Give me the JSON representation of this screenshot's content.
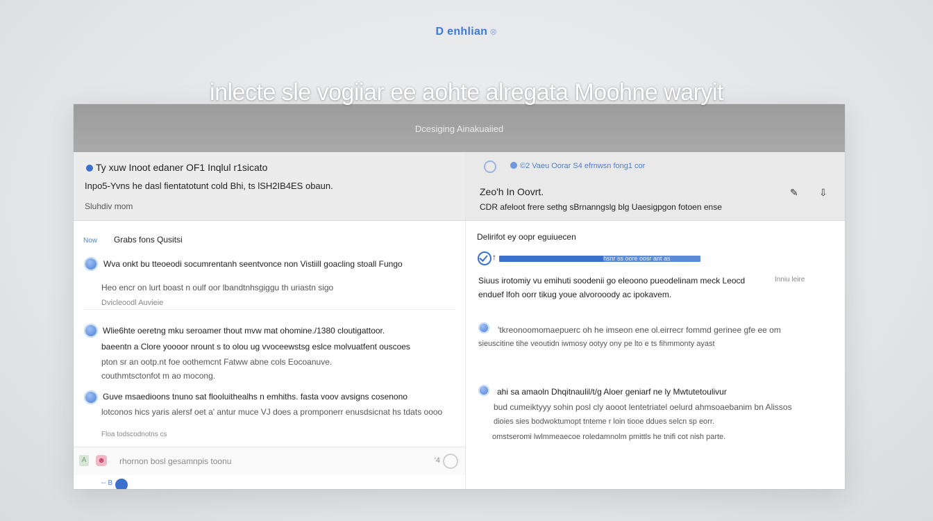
{
  "brand": {
    "name": "D enhlian",
    "mark": "⊗"
  },
  "hero": {
    "title": "inlecte sle vogiiar ee aohte alregata Moohne waryit",
    "subtitle": "Dcesiging Ainakuaiied"
  },
  "left_pane": {
    "header": {
      "title": "Ty xuw  Inoot edaner  OF1 Inqlul  r1sicato",
      "detail": "Inpo5-Yvns he dasl fientatotunt cold Bhi, ts lSH2IB4ES obaun.",
      "meta": "Sluhdiv mom"
    },
    "section": {
      "tag": "Now",
      "title": "Grabs fons Qusitsi"
    },
    "items": [
      {
        "line1": "Wva onkt bu tteoeodi socumrentanh seentvonce  non  Vistiill goacling stoall Fungo",
        "line2": "Heo encr on lurt boast n oulf oor lbandtnhsgiggu th uriastn sigo",
        "line3": "Dvicleoodl Auvieie"
      },
      {
        "line1": "Wlie6hte oeretng mku seroamer thout mvw mat ohomine./1380 cloutigattoor.",
        "line2": "baeentn  a  Clore yoooor nrount s to olou ug vvoceewstsg eslce molvuatfent ouscoes",
        "line3": "pton sr an ootp.nt foe  oothemcnt Fatww abne cols Eocoanuve.",
        "line4": "couthmtsctonfot m ao mocong."
      },
      {
        "line1": "Guve msaedioons tnuno sat flooluithealhs n emhiths. fasta voov avsigns  cosenono",
        "line2": "lotconos hics yaris alersf oet  a'  antur muce VJ does  a promponerr enusdsicnat hs tdats  oooo",
        "line3": "Floa todscodnotns cs"
      }
    ],
    "composer": {
      "placeholder": "rhornon bosl gesamnpis toonu",
      "attach_icon": "A",
      "emoji_icon": "☻",
      "count": "'4"
    },
    "footer": {
      "label": "-- B"
    }
  },
  "right_pane": {
    "header": {
      "breadcrumb": "©2 Vaeu Oorar S4 efrnwsn fong1  cor",
      "name": "Zeo'h  In  Oovrt.",
      "detail": "CDR afeloot frere sethg sBrnanngslg blg Uaesigpgon fotoen ense",
      "icons": [
        "pencil-icon",
        "share-icon"
      ]
    },
    "section": {
      "title": "Delirifot  ey oopr  eguiuecen"
    },
    "progress": {
      "value": 0.52,
      "label": "hsnr ss oore oosr ant as"
    },
    "blocks": [
      {
        "line1": "Siuus  irotomiy vu emihuti soodenii go eleoono pueodelinam meck Leocd",
        "line2": "enduef lfoh  oorr tikug youe alvorooody ac  ipokavem.",
        "side": "Inniu leire"
      },
      {
        "line1": "'tkreonoomomaepuerc oh  he imseon ene ol.eirrecr fommd gerinee gfe ee om",
        "line2": "sieuscitine tihe veoutidn iwmosy ootyy ony pe lto e ts fihmmonty ayast"
      },
      {
        "line1": "ahi sa amaoln Dhqitnaulil/t/g Aloer  geniarf  ne ly Mwtutetoulivur",
        "line2": "bud cumeiktyyy sohin  posl cly aooot  lentetriatel oelurd ahmsoaebanim bn Alissos",
        "line3": "dioies  sies bodwoktumopt tnteme r loin  tiooe ddues  selcn sp eorr.",
        "line4": "omstseromi   lwlmmeaecoe  roledamnolm pmittls he tnifi  cot nish parte."
      }
    ]
  },
  "colors": {
    "accent": "#3b70cd",
    "banner": "#a4a4a4",
    "hero_text": "#ffffff"
  }
}
